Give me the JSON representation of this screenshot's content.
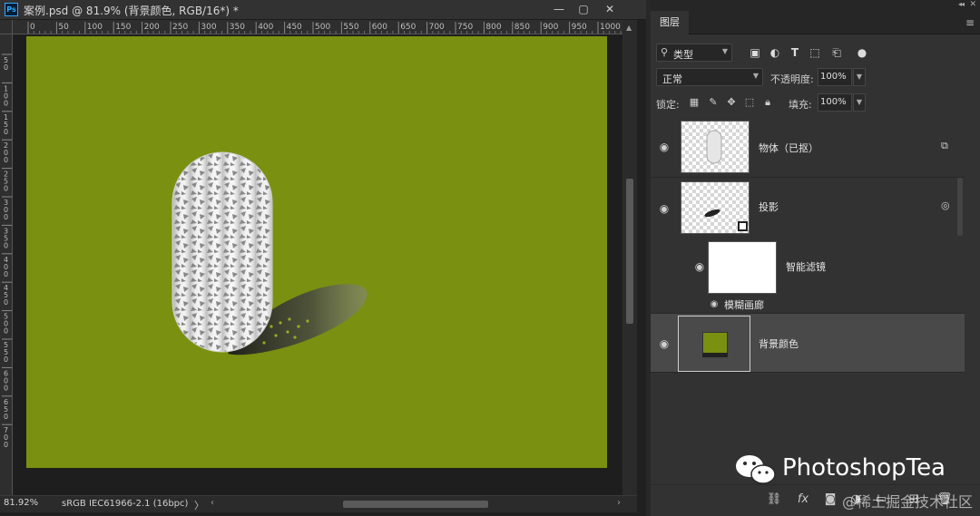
{
  "document": {
    "title": "案例.psd @ 81.9% (背景颜色, RGB/16*) *",
    "app_icon_text": "Ps",
    "window_buttons": [
      "—",
      "▢",
      "✕"
    ],
    "ruler_top_ticks": [
      "0",
      "50",
      "100",
      "150",
      "200",
      "250",
      "300",
      "350",
      "400",
      "450",
      "500",
      "550",
      "600",
      "650",
      "700",
      "750",
      "800",
      "850",
      "900",
      "950",
      "1000"
    ],
    "ruler_left_ticks": [
      "5\n0",
      "1\n0\n0",
      "1\n5\n0",
      "2\n0\n0",
      "2\n5\n0",
      "3\n0\n0",
      "3\n5\n0",
      "4\n0\n0",
      "4\n5\n0",
      "5\n0\n0",
      "5\n5\n0",
      "6\n0\n0",
      "6\n5\n0",
      "7\n0\n0"
    ],
    "canvas_color": "#7a9010",
    "status": {
      "zoom": "81.92%",
      "profile": "sRGB IEC61966-2.1 (16bpc)",
      "arrow": "〉"
    }
  },
  "layers_panel": {
    "tab": "图层",
    "filter_label": "类型",
    "filter_icons": [
      "image-filter-icon",
      "adjustment-filter-icon",
      "type-filter-icon",
      "shape-filter-icon",
      "smart-object-filter-icon",
      "filter-toggle-icon"
    ],
    "blend_mode": "正常",
    "opacity_label": "不透明度:",
    "opacity_value": "100%",
    "lock_label": "锁定:",
    "fill_label": "填充:",
    "fill_value": "100%",
    "layers": [
      {
        "name": "物体（已抠）",
        "type": "smart-object"
      },
      {
        "name": "投影",
        "type": "smart-object",
        "smart_filters": "智能滤镜",
        "filter_item": "模糊画廊"
      },
      {
        "name": "背景颜色",
        "type": "fill",
        "selected": true,
        "color": "#7a9010"
      }
    ],
    "bottom_icons": [
      "link-icon",
      "fx-icon",
      "mask-icon",
      "adjustment-icon",
      "group-icon",
      "new-layer-icon",
      "delete-icon"
    ]
  },
  "watermark": {
    "brand": "PhotoshopTea",
    "juejin": "@稀土掘金技术社区"
  }
}
